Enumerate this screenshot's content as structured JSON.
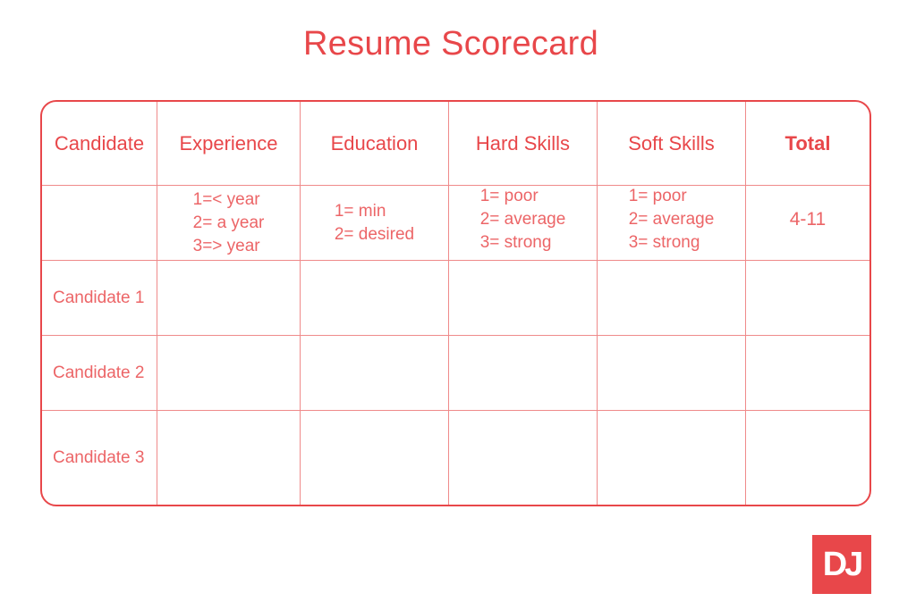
{
  "title": "Resume Scorecard",
  "table": {
    "headers": [
      "Candidate",
      "Experience",
      "Education",
      "Hard Skills",
      "Soft Skills",
      "Total"
    ],
    "scale_row": {
      "candidate": "",
      "experience": [
        "1=< year",
        "2= a year",
        "3=> year"
      ],
      "education": [
        "1= min",
        "2= desired"
      ],
      "hard_skills": [
        "1= poor",
        "2= average",
        "3= strong"
      ],
      "soft_skills": [
        "1= poor",
        "2= average",
        "3= strong"
      ],
      "total": "4-11"
    },
    "rows": [
      {
        "candidate": "Candidate 1",
        "experience": "",
        "education": "",
        "hard_skills": "",
        "soft_skills": "",
        "total": ""
      },
      {
        "candidate": "Candidate 2",
        "experience": "",
        "education": "",
        "hard_skills": "",
        "soft_skills": "",
        "total": ""
      },
      {
        "candidate": "Candidate 3",
        "experience": "",
        "education": "",
        "hard_skills": "",
        "soft_skills": "",
        "total": ""
      }
    ]
  },
  "logo": {
    "text": "DJ"
  },
  "colors": {
    "accent": "#e8474a",
    "grid": "#ef8a8a"
  }
}
